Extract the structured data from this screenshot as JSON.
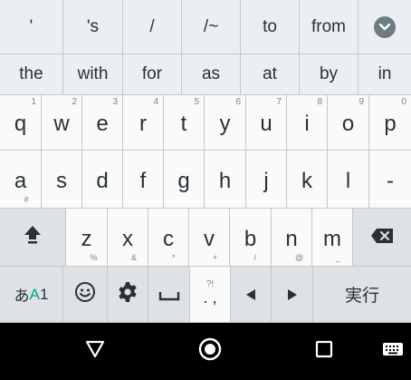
{
  "suggestions_row1": [
    "'",
    "'s",
    "/",
    "/~",
    "to",
    "from"
  ],
  "suggestions_row2": [
    "the",
    "with",
    "for",
    "as",
    "at",
    "by",
    "in"
  ],
  "row_q": [
    {
      "k": "q",
      "h": "1"
    },
    {
      "k": "w",
      "h": "2"
    },
    {
      "k": "e",
      "h": "3"
    },
    {
      "k": "r",
      "h": "4"
    },
    {
      "k": "t",
      "h": "5"
    },
    {
      "k": "y",
      "h": "6"
    },
    {
      "k": "u",
      "h": "7"
    },
    {
      "k": "i",
      "h": "8"
    },
    {
      "k": "o",
      "h": "9"
    },
    {
      "k": "p",
      "h": "0"
    }
  ],
  "row_a": [
    {
      "k": "a",
      "s": "#"
    },
    {
      "k": "s",
      "s": ""
    },
    {
      "k": "d",
      "s": ""
    },
    {
      "k": "f",
      "s": ""
    },
    {
      "k": "g",
      "s": ""
    },
    {
      "k": "h",
      "s": ""
    },
    {
      "k": "j",
      "s": ""
    },
    {
      "k": "k",
      "s": ""
    },
    {
      "k": "l",
      "s": ""
    },
    {
      "k": "-",
      "s": ""
    }
  ],
  "row_z": [
    {
      "k": "z",
      "s": "%"
    },
    {
      "k": "x",
      "s": "&"
    },
    {
      "k": "c",
      "s": "*"
    },
    {
      "k": "v",
      "s": "+"
    },
    {
      "k": "b",
      "s": "/"
    },
    {
      "k": "n",
      "s": "@"
    },
    {
      "k": "m",
      "s": "_"
    }
  ],
  "fn_row": {
    "lang_prefix": "あ",
    "lang_a": "A",
    "lang_num": "1",
    "punct_top": "?!",
    "punct_main": ". ,",
    "enter_label": "実行"
  },
  "icons": {
    "collapse": "chevron-down-icon",
    "shift": "shift-icon",
    "backspace": "backspace-icon",
    "emoji": "emoji-icon",
    "settings": "gear-icon",
    "space": "space-icon",
    "left": "arrow-left-icon",
    "right": "arrow-right-icon",
    "nav_back": "back-triangle-icon",
    "nav_home": "home-circle-icon",
    "nav_recents": "recents-square-icon",
    "nav_keyboard": "keyboard-icon"
  },
  "colors": {
    "key_bg": "#fafafa",
    "fn_key_bg": "#dfe2e5",
    "suggestion_bg": "#eceff1",
    "accent_green": "#00a88f",
    "nav_bg": "#000000"
  }
}
